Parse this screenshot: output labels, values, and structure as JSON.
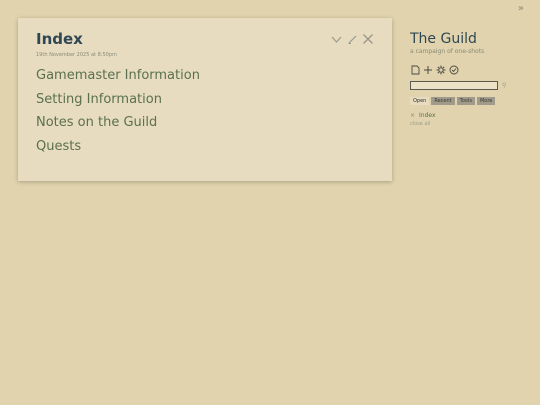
{
  "tiddler": {
    "title": "Index",
    "subtitle": "19th November 2025 at 8:50pm",
    "links": [
      "Gamemaster Information",
      "Setting Information",
      "Notes on the Guild",
      "Quests"
    ],
    "controls": [
      "chevron-down-icon",
      "edit-icon",
      "close-icon"
    ]
  },
  "sidebar": {
    "title": "The Guild",
    "subtitle": "a campaign of one-shots",
    "page_controls": [
      "new-tiddler-icon",
      "add-icon",
      "settings-icon",
      "check-icon"
    ],
    "search": {
      "value": "",
      "placeholder": ""
    },
    "tabs": [
      "Open",
      "Recent",
      "Tools",
      "More"
    ],
    "active_tab": "Open",
    "open_items": [
      "Index"
    ],
    "close_all_label": "close all"
  },
  "toggle_glyph": "»",
  "search_glyph": "⚲",
  "close_glyph": "×",
  "colors": {
    "background": "#e0d3ad",
    "tiddler_bg": "#e8dcc0",
    "title": "#2f4754",
    "link": "#5a7050",
    "tab_bg": "#a09a8a"
  }
}
